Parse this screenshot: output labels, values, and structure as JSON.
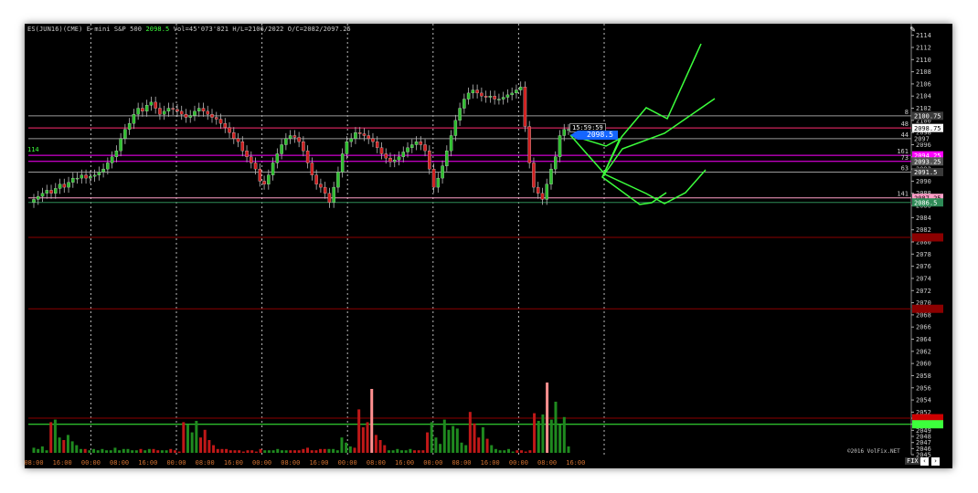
{
  "window": {
    "symbol": "ES(JUN16)(CME) E-mini S&P 500",
    "last": "2098.5",
    "stats": "Vol=45'073'821 H/L=2106/2022 O/C=2082/2097.25",
    "copyright": "©2016 VolFix.NET",
    "fix_label": "FIX",
    "nav_prev": "‹",
    "nav_next": "›",
    "pen_icon": "✎",
    "left_label": "114",
    "last_time": "15:59:59",
    "last_price_flag": "2098.5"
  },
  "colors": {
    "background": "#000000",
    "up": "#2fbf2f",
    "down": "#d02020",
    "drawing": "#3cff3c",
    "accent_blue": "#1565ff",
    "magenta": "#ff00ff",
    "pink": "#ff9fc8"
  },
  "chart_data": {
    "type": "candlestick",
    "ylim": [
      2045,
      2115
    ],
    "y_ticks": [
      2045,
      2046,
      2047,
      2048,
      2049,
      2050,
      2051,
      2052,
      2054,
      2056,
      2058,
      2060,
      2062,
      2064,
      2066,
      2068,
      2070,
      2072,
      2074,
      2076,
      2078,
      2080,
      2082,
      2084,
      2086,
      2088,
      2090,
      2092,
      2094,
      2096,
      2098,
      2100,
      2102,
      2104,
      2106,
      2108,
      2110,
      2112,
      2114
    ],
    "x_tick_labels": [
      "08:00",
      "16:00",
      "00:00",
      "08:00",
      "16:00",
      "00:00",
      "08:00",
      "16:00",
      "00:00",
      "08:00",
      "16:00",
      "00:00",
      "08:00",
      "16:00",
      "00:00",
      "08:00",
      "16:00",
      "00:00",
      "08:00",
      "16:00"
    ],
    "day_separators_at_ticks": [
      2,
      5,
      8,
      11,
      14,
      17,
      20
    ],
    "levels": [
      {
        "price": 2100.75,
        "label": "2100.75",
        "left_label": "8",
        "color": "#9a9a9a",
        "tag_bg": "#3a3a3a",
        "tag_fg": "#ffffff"
      },
      {
        "price": 2098.75,
        "label": "2098.75",
        "left_label": "48",
        "color": "#ff2d6f",
        "tag_bg": "#ffffff",
        "tag_fg": "#000000"
      },
      {
        "price": 2097.0,
        "label": "2097",
        "left_label": "44",
        "color": "#9a9a9a",
        "tag_bg": "#000000",
        "tag_fg": "#cccccc"
      },
      {
        "price": 2094.25,
        "label": "2094.25",
        "left_label": "161",
        "color": "#ff00ff",
        "tag_bg": "#ff00ff",
        "tag_fg": "#ffffff"
      },
      {
        "price": 2093.25,
        "label": "2093.25",
        "left_label": "73",
        "color": "#ff00ff",
        "tag_bg": "#555555",
        "tag_fg": "#ffffff"
      },
      {
        "price": 2091.5,
        "label": "2091.5",
        "left_label": "63",
        "color": "#9a9a9a",
        "tag_bg": "#3a3a3a",
        "tag_fg": "#ffffff"
      },
      {
        "price": 2087.25,
        "label": "2087.25",
        "left_label": "141",
        "color": "#ff9fc8",
        "tag_bg": "#ff9fc8",
        "tag_fg": "#000000"
      },
      {
        "price": 2086.5,
        "label": "2086.5",
        "left_label": "",
        "color": "#2e8b57",
        "tag_bg": "#2e8b57",
        "tag_fg": "#ffffff"
      },
      {
        "price": 2080.75,
        "label": "",
        "left_label": "",
        "color": "#8b0000",
        "tag_bg": "#8b0000",
        "tag_fg": "#ffffff"
      },
      {
        "price": 2069.0,
        "label": "",
        "left_label": "",
        "color": "#8b0000",
        "tag_bg": "#8b0000",
        "tag_fg": "#ffffff"
      },
      {
        "price": 2051.0,
        "label": "",
        "left_label": "",
        "color": "#8b0000",
        "tag_bg": "#cc0000",
        "tag_fg": "#ffffff"
      },
      {
        "price": 2050.0,
        "label": "",
        "left_label": "",
        "color": "#3cff3c",
        "tag_bg": "#3cff3c",
        "tag_fg": "#000000"
      }
    ],
    "closes": [
      2087,
      2087.5,
      2088,
      2088.5,
      2088,
      2088.8,
      2089.5,
      2089,
      2089.8,
      2090.5,
      2090.5,
      2091,
      2090.5,
      2090.8,
      2091,
      2091.5,
      2092,
      2093,
      2094,
      2095,
      2097,
      2098.5,
      2099.5,
      2101,
      2102,
      2101.5,
      2102.5,
      2103,
      2102,
      2101,
      2101.5,
      2102,
      2101.8,
      2101.5,
      2101,
      2100.5,
      2100.8,
      2101.5,
      2102,
      2101.5,
      2101,
      2100.5,
      2100.2,
      2099.5,
      2098.8,
      2098,
      2097,
      2096.5,
      2095,
      2094,
      2093,
      2092,
      2090,
      2089.5,
      2091,
      2093,
      2094.5,
      2096,
      2097,
      2097.5,
      2097.2,
      2096.5,
      2095,
      2093,
      2091,
      2089.5,
      2089,
      2088,
      2086.5,
      2089,
      2091.5,
      2094.5,
      2096.5,
      2097,
      2098,
      2097.8,
      2097.5,
      2097,
      2096.5,
      2095.5,
      2094.5,
      2093.8,
      2093.2,
      2093.5,
      2094,
      2094.8,
      2095.5,
      2096,
      2096.5,
      2096,
      2095,
      2092,
      2089,
      2090.5,
      2092.5,
      2095,
      2097.5,
      2100,
      2102,
      2103.5,
      2104.5,
      2105,
      2104.5,
      2104,
      2103.8,
      2104,
      2103.5,
      2103.5,
      2103.8,
      2104.2,
      2104.5,
      2105,
      2105.5,
      2099,
      2093,
      2089,
      2088,
      2087,
      2089.5,
      2092,
      2094,
      2097.5,
      2098.5,
      2098.5
    ],
    "volume": [
      4,
      3,
      5,
      2,
      24,
      26,
      12,
      10,
      14,
      9,
      6,
      3,
      3,
      2,
      3,
      2,
      3,
      2,
      2,
      4,
      2,
      3,
      3,
      2,
      2,
      3,
      2,
      3,
      3,
      2,
      2,
      2,
      3,
      2,
      1,
      24,
      22,
      16,
      25,
      12,
      18,
      10,
      6,
      3,
      3,
      3,
      2,
      2,
      2,
      1,
      2,
      2,
      1,
      3,
      2,
      2,
      2,
      3,
      2,
      2,
      2,
      2,
      2,
      3,
      4,
      2,
      2,
      3,
      3,
      3,
      3,
      2,
      12,
      8,
      5,
      4,
      34,
      20,
      24,
      50,
      14,
      10,
      6,
      2,
      2,
      3,
      2,
      2,
      3,
      2,
      2,
      2,
      16,
      24,
      12,
      7,
      26,
      18,
      21,
      19,
      8,
      6,
      32,
      23,
      12,
      20,
      11,
      6,
      3,
      2,
      2,
      3,
      1,
      2,
      2,
      1,
      2,
      31,
      25,
      30,
      55,
      26,
      40,
      22,
      28,
      5
    ]
  }
}
